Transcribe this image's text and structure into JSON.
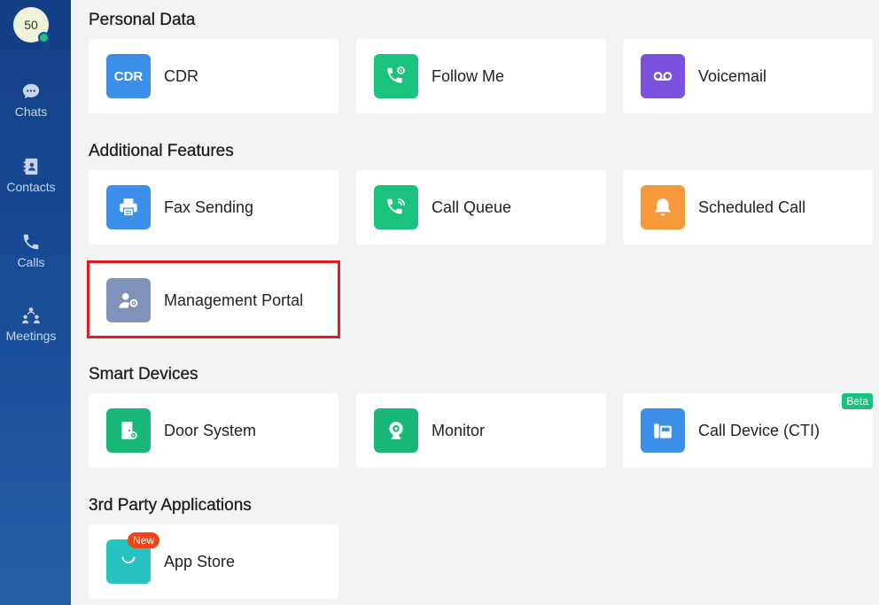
{
  "user": {
    "avatar_text": "50",
    "status": "online"
  },
  "nav": [
    {
      "id": "chats",
      "label": "Chats",
      "icon": "chat-bubble-icon"
    },
    {
      "id": "contacts",
      "label": "Contacts",
      "icon": "contacts-book-icon"
    },
    {
      "id": "calls",
      "label": "Calls",
      "icon": "phone-icon"
    },
    {
      "id": "meetings",
      "label": "Meetings",
      "icon": "meeting-people-icon"
    }
  ],
  "sections": {
    "personal": {
      "title": "Personal Data"
    },
    "additional": {
      "title": "Additional Features"
    },
    "smart": {
      "title": "Smart Devices"
    },
    "third_party": {
      "title": "3rd Party Applications"
    }
  },
  "cards": {
    "cdr": {
      "label": "CDR",
      "icon_text": "CDR",
      "color": "#3b8fe8",
      "icon": "cdr-icon"
    },
    "follow_me": {
      "label": "Follow Me",
      "color": "#19c37d",
      "icon": "phone-settings-icon"
    },
    "voicemail": {
      "label": "Voicemail",
      "color": "#7b52e0",
      "icon": "voicemail-icon"
    },
    "fax": {
      "label": "Fax Sending",
      "color": "#3b8fe8",
      "icon": "printer-icon"
    },
    "call_queue": {
      "label": "Call Queue",
      "color": "#19c37d",
      "icon": "phone-queue-icon"
    },
    "scheduled_call": {
      "label": "Scheduled Call",
      "color": "#f59a3a",
      "icon": "bell-icon"
    },
    "management_portal": {
      "label": "Management Portal",
      "color": "#7f93b8",
      "icon": "admin-user-gear-icon"
    },
    "door_system": {
      "label": "Door System",
      "color": "#19b879",
      "icon": "door-gear-icon"
    },
    "monitor": {
      "label": "Monitor",
      "color": "#19b879",
      "icon": "camera-icon"
    },
    "call_device": {
      "label": "Call Device (CTI)",
      "color": "#3b8fe8",
      "icon": "desk-phone-icon",
      "badge": "Beta"
    },
    "app_store": {
      "label": "App Store",
      "color": "#25c4c0",
      "icon": "shopping-bag-icon",
      "badge": "New"
    }
  },
  "colors": {
    "highlight": "#e01b22",
    "beta": "#19c37d",
    "new": "#ef4417"
  }
}
